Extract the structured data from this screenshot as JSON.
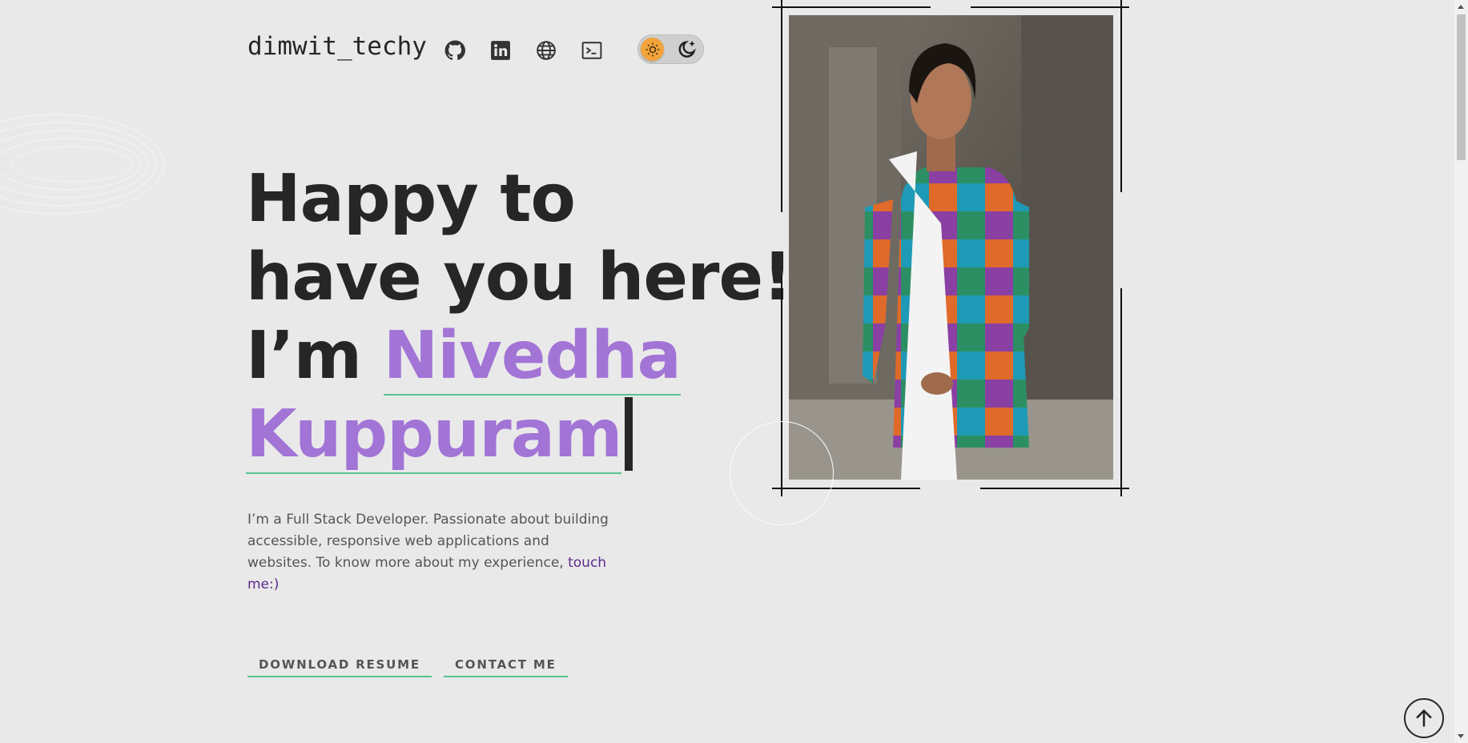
{
  "header": {
    "brand": "dimwit_techy",
    "social_icons": [
      "github-icon",
      "linkedin-icon",
      "globe-icon",
      "terminal-icon"
    ],
    "theme_toggle": {
      "light_icon": "sun-icon",
      "dark_icon": "moon-icon"
    }
  },
  "hero": {
    "line1": "Happy to",
    "line2": "have you here!",
    "line3_prefix": "I’m",
    "name_first": "Nivedha",
    "name_last": "Kuppuram"
  },
  "about": {
    "text": "I’m a Full Stack Developer. Passionate about building accessible, responsive web applications and websites. To know more about my experience,",
    "link": "touch me:)"
  },
  "buttons": {
    "resume": "DOWNLOAD RESUME",
    "contact": "CONTACT ME"
  },
  "colors": {
    "background": "#e9e9e9",
    "text": "#262626",
    "accent_name": "#a274d6",
    "underline": "#56c48f",
    "link": "#5c2a8a",
    "sun": "#f2a33a"
  },
  "scroll_to_top_icon": "arrow-up-icon"
}
